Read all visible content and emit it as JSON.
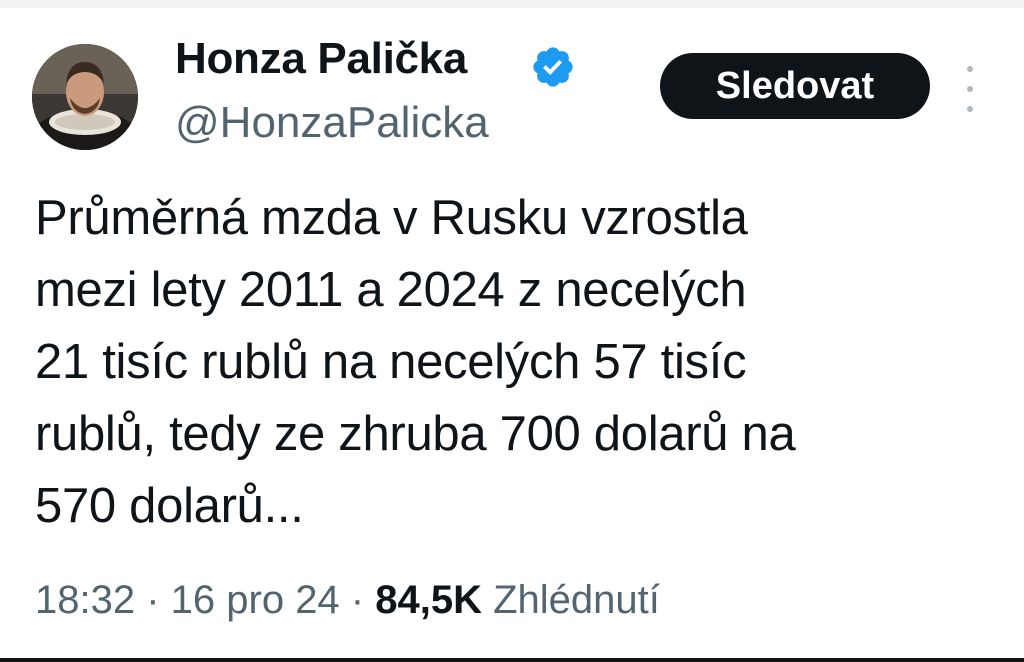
{
  "author": {
    "display_name": "Honza Palička",
    "handle": "@HonzaPalicka",
    "verified_icon": "verified-badge-icon",
    "avatar_icon": "avatar-portrait"
  },
  "actions": {
    "follow_label": "Sledovat",
    "more_icon": "more-options-icon"
  },
  "tweet": {
    "text_lines": [
      "Průměrná mzda v Rusku vzrostla",
      "mezi lety 2011 a 2024 z necelých",
      "21 tisíc rublů na necelých 57 tisíc",
      "rublů, tedy ze zhruba 700 dolarů na",
      "570 dolarů..."
    ]
  },
  "meta": {
    "time": "18:32",
    "separator": " · ",
    "date": "16 pro 24",
    "views_count": "84,5K",
    "views_label": "Zhlédnutí"
  },
  "colors": {
    "text": "#0f1419",
    "secondary": "#536471",
    "verified": "#1d9bf0",
    "button_bg": "#0f1419"
  }
}
